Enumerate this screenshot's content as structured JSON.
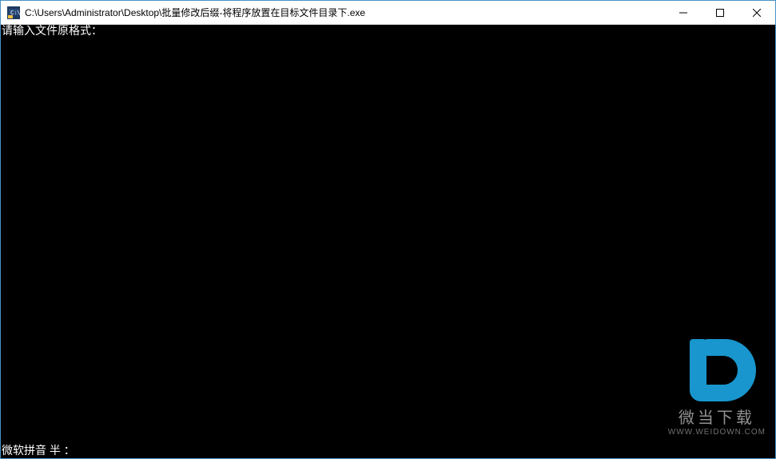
{
  "window": {
    "title": "C:\\Users\\Administrator\\Desktop\\批量修改后缀-将程序放置在目标文件目录下.exe"
  },
  "console": {
    "prompt_line": "请输入文件原格式：",
    "ime_status": "微软拼音  半 ："
  },
  "watermark": {
    "title": "微当下载",
    "url": "WWW.WEIDOWN.COM"
  }
}
